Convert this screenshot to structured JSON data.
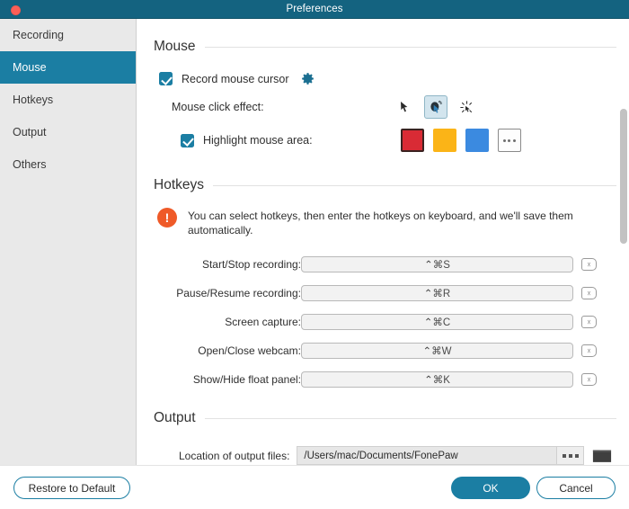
{
  "window": {
    "title": "Preferences",
    "close_button": "close-dot"
  },
  "sidebar": {
    "items": [
      {
        "label": "Recording",
        "selected": false
      },
      {
        "label": "Mouse",
        "selected": true
      },
      {
        "label": "Hotkeys",
        "selected": false
      },
      {
        "label": "Output",
        "selected": false
      },
      {
        "label": "Others",
        "selected": false
      }
    ]
  },
  "mouse_section": {
    "heading": "Mouse",
    "record_cursor": {
      "label": "Record mouse cursor",
      "checked": true,
      "settings_icon": "gear-icon"
    },
    "click_effect": {
      "label": "Mouse click effect:",
      "options": [
        {
          "name": "plain-cursor",
          "selected": false
        },
        {
          "name": "cursor-with-click-ring",
          "selected": true
        },
        {
          "name": "click-burst",
          "selected": false
        }
      ]
    },
    "highlight_area": {
      "label": "Highlight mouse area:",
      "checked": true,
      "colors": [
        {
          "name": "red",
          "hex": "#d92b35",
          "selected": true
        },
        {
          "name": "yellow",
          "hex": "#fbb417",
          "selected": false
        },
        {
          "name": "blue",
          "hex": "#3b8ae0",
          "selected": false
        }
      ],
      "more_label": "more-colors"
    }
  },
  "hotkeys_section": {
    "heading": "Hotkeys",
    "notice": "You can select hotkeys, then enter the hotkeys on keyboard, and we'll save them automatically.",
    "rows": [
      {
        "label": "Start/Stop recording:",
        "value": "⌃⌘S"
      },
      {
        "label": "Pause/Resume recording:",
        "value": "⌃⌘R"
      },
      {
        "label": "Screen capture:",
        "value": "⌃⌘C"
      },
      {
        "label": "Open/Close webcam:",
        "value": "⌃⌘W"
      },
      {
        "label": "Show/Hide float panel:",
        "value": "⌃⌘K"
      }
    ],
    "clear_icon": "backspace-delete-icon"
  },
  "output_section": {
    "heading": "Output",
    "location_label": "Location of output files:",
    "location_value": "/Users/mac/Documents/FonePaw",
    "more_button": "ellipsis-button",
    "browse_button": "folder-icon"
  },
  "footer": {
    "restore_label": "Restore to Default",
    "ok_label": "OK",
    "cancel_label": "Cancel"
  },
  "colors": {
    "accent": "#1b7ea3",
    "titlebar": "#146380",
    "warning": "#ef5a28",
    "sidebar_bg": "#e9e9e9"
  }
}
